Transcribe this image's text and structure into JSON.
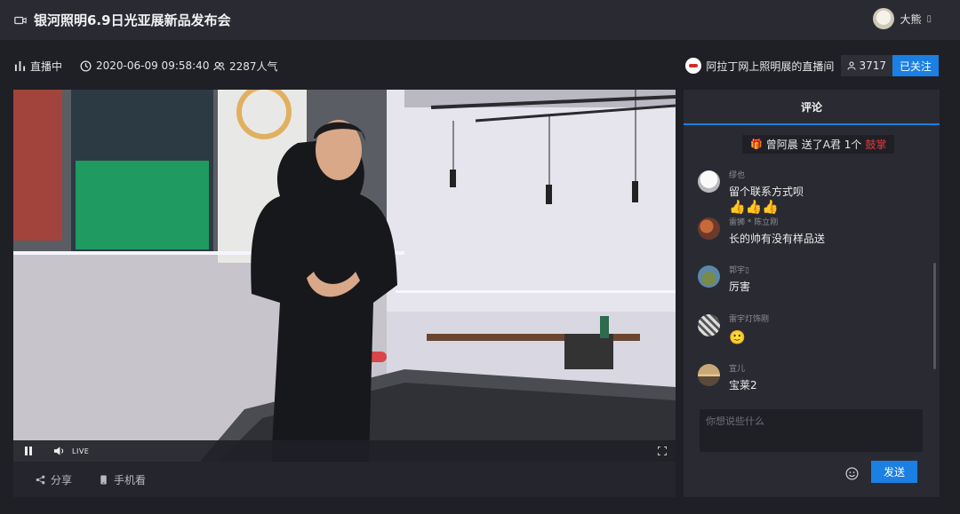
{
  "header": {
    "title": "银河照明6.9日光亚展新品发布会",
    "user_name": "大熊",
    "user_caret": "▯"
  },
  "status": {
    "live_label": "直播中",
    "datetime": "2020-06-09 09:58:40",
    "popularity": "2287人气"
  },
  "host": {
    "name": "阿拉丁网上照明展的直播间",
    "followers": "3717",
    "follow_label": "已关注"
  },
  "player": {
    "live_badge": "LIVE"
  },
  "actions": {
    "share": "分享",
    "mobile": "手机看"
  },
  "chat": {
    "tab": "评论",
    "gift_message": {
      "sender": "曾阿晨",
      "text": "送了A君 1个",
      "gift": "鼓掌"
    },
    "comments": [
      {
        "name": "缪也",
        "text": "留个联系方式呗",
        "extra": "👍👍👍"
      },
      {
        "name": "雷狮 * 陈立刚",
        "text": "长的帅有没有样品送"
      },
      {
        "name": "郭宇▯",
        "text": "厉害"
      },
      {
        "name": "雷宇灯饰刚",
        "text": "🙂"
      },
      {
        "name": "宣儿",
        "text": "宝莱2"
      }
    ],
    "input_placeholder": "你想说些什么",
    "send_label": "发送"
  },
  "colors": {
    "accent": "#1b7fe3",
    "background": "#1f2026",
    "panel": "#2a2b32",
    "gift_icon": "#f2b43c",
    "gift_highlight": "#e03b3b"
  }
}
